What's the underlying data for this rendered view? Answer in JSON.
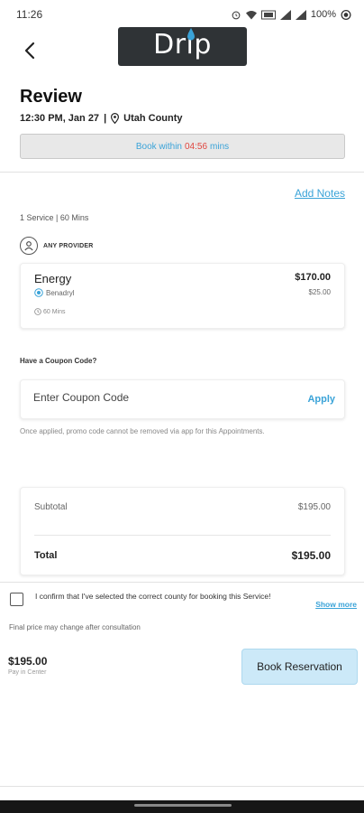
{
  "status_bar": {
    "time": "11:26",
    "battery": "100%"
  },
  "header": {
    "logo_text": "Drip"
  },
  "review": {
    "title": "Review",
    "datetime": "12:30 PM, Jan 27",
    "separator": "|",
    "location": "Utah County",
    "timer_prefix": "Book within",
    "timer_value": "04:56",
    "timer_suffix": "mins"
  },
  "notes": {
    "add_notes_label": "Add Notes"
  },
  "service_summary": "1 Service | 60 Mins",
  "provider": {
    "label": "ANY PROVIDER"
  },
  "service": {
    "name": "Energy",
    "price": "$170.00",
    "addon_name": "Benadryl",
    "addon_price": "$25.00",
    "duration": "60 Mins"
  },
  "coupon": {
    "question": "Have a Coupon Code?",
    "placeholder": "Enter Coupon Code",
    "apply_label": "Apply",
    "note": "Once applied, promo code cannot be removed via app for this Appointments."
  },
  "totals": {
    "subtotal_label": "Subtotal",
    "subtotal_value": "$195.00",
    "total_label": "Total",
    "total_value": "$195.00"
  },
  "confirm": {
    "text": "I confirm that I've selected the correct county for booking this Service!",
    "show_more_label": "Show more",
    "final_note": "Final price may change after consultation"
  },
  "footer": {
    "price": "$195.00",
    "pay_note": "Pay in Center",
    "book_label": "Book Reservation"
  },
  "colors": {
    "accent": "#3aa3d8",
    "timer_red": "#e0463f",
    "book_button_bg": "#cce9f8",
    "logo_bg": "#2f3336"
  },
  "icons": [
    "alarm-icon",
    "wifi-icon",
    "signal-icon",
    "battery-icon",
    "back-arrow-icon",
    "location-pin-icon",
    "person-icon",
    "addon-check-icon",
    "clock-icon"
  ]
}
